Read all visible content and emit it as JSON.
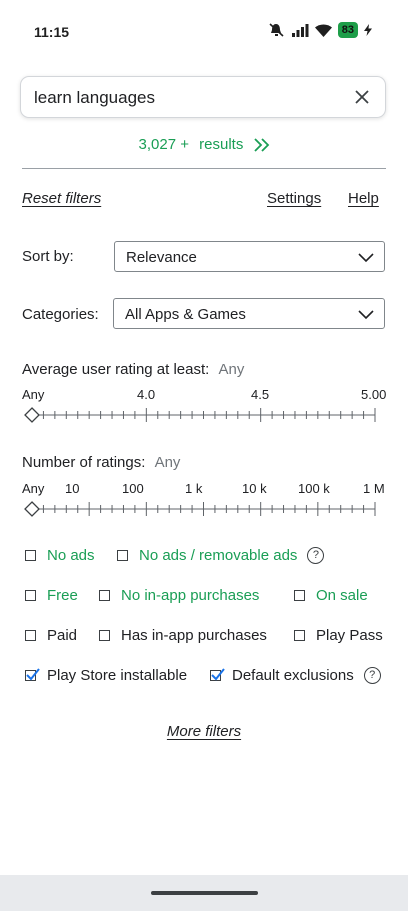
{
  "status": {
    "time": "11:15",
    "battery": "83"
  },
  "search": {
    "query": "learn languages"
  },
  "results": {
    "count": "3,027 +",
    "label": "results"
  },
  "links": {
    "reset": "Reset filters",
    "settings": "Settings",
    "help": "Help",
    "more": "More filters"
  },
  "sort": {
    "label": "Sort by:",
    "value": "Relevance"
  },
  "categories": {
    "label": "Categories:",
    "value": "All Apps & Games"
  },
  "rating": {
    "label": "Average user rating at least:",
    "value": "Any",
    "ticks": [
      "Any",
      "4.0",
      "4.5",
      "5.00"
    ],
    "selected_fraction": 0
  },
  "num_ratings": {
    "label": "Number of ratings:",
    "value": "Any",
    "ticks": [
      "Any",
      "10",
      "100",
      "1 k",
      "10 k",
      "100 k",
      "1 M"
    ],
    "selected_fraction": 0
  },
  "checkboxes": {
    "no_ads": {
      "label": "No ads",
      "checked": false
    },
    "no_ads_removable": {
      "label": "No ads / removable ads",
      "checked": false
    },
    "free": {
      "label": "Free",
      "checked": false
    },
    "no_iap": {
      "label": "No in-app purchases",
      "checked": false
    },
    "on_sale": {
      "label": "On sale",
      "checked": false
    },
    "paid": {
      "label": "Paid",
      "checked": false
    },
    "has_iap": {
      "label": "Has in-app purchases",
      "checked": false
    },
    "play_pass": {
      "label": "Play Pass",
      "checked": false
    },
    "installable": {
      "label": "Play Store installable",
      "checked": true
    },
    "default_exclusions": {
      "label": "Default exclusions",
      "checked": true
    }
  },
  "help_glyph": "?",
  "colors": {
    "accent": "#1a9e55",
    "check": "#1a73e8",
    "battery": "#1e9e49"
  }
}
